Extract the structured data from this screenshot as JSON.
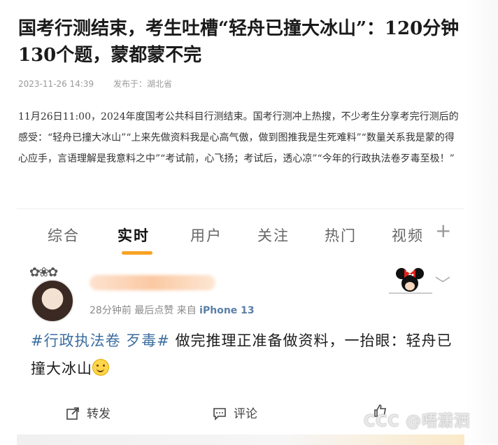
{
  "article": {
    "title": "国考行测结束，考生吐槽“轻舟已撞大冰山”：120分钟130个题，蒙都蒙不完",
    "date": "2023-11-26 14:39",
    "source": "发布于：湖北省",
    "body": "11月26日11:00，2024年度国考公共科目行测结束。国考行测冲上热搜，不少考生分享考完行测后的感受：“轻舟已撞大冰山”“上来先做资料我是心高气傲，做到图推我是生死难料”“数量关系我是蒙的得心应手，言语理解是我意料之中”“考试前，心飞扬；考试后，透心凉”“今年的行政执法卷歹毒至极！”"
  },
  "screenshot": {
    "tabs": [
      "综合",
      "实时",
      "用户",
      "关注",
      "热门",
      "视频"
    ],
    "active_tab": "实时",
    "accent_color": "#f7a325",
    "post": {
      "meta_prefix": "28分钟前 最后点赞 来自",
      "device": "iPhone 13",
      "hashtag": "#行政执法卷 歹毒#",
      "text": "做完推理正准备做资料，一抬眼：轻舟已撞大冰山",
      "repost_label": "转发",
      "comment_label": "评论"
    }
  },
  "watermark": "CCC @唔潇洒"
}
